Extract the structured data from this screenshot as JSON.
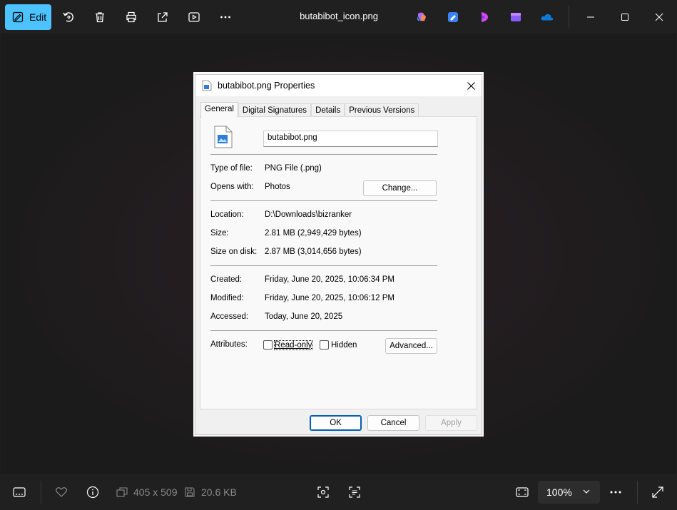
{
  "toolbar": {
    "edit_label": "Edit",
    "title": "butabibot_icon.png"
  },
  "dialog": {
    "title": "butabibot.png Properties",
    "tabs": [
      "General",
      "Digital Signatures",
      "Details",
      "Previous Versions"
    ],
    "file_name": "butabibot.png",
    "type_label": "Type of file:",
    "type_value": "PNG File (.png)",
    "opens_label": "Opens with:",
    "opens_value": "Photos",
    "change_button": "Change...",
    "location_label": "Location:",
    "location_value": "D:\\Downloads\\bizranker",
    "size_label": "Size:",
    "size_value": "2.81 MB (2,949,429 bytes)",
    "size_disk_label": "Size on disk:",
    "size_disk_value": "2.87 MB (3,014,656 bytes)",
    "created_label": "Created:",
    "created_value": "Friday, June 20, 2025, 10:06:34 PM",
    "modified_label": "Modified:",
    "modified_value": "Friday, June 20, 2025, 10:06:12 PM",
    "accessed_label": "Accessed:",
    "accessed_value": "Today, June 20, 2025",
    "attributes_label": "Attributes:",
    "readonly_label": "Read-only",
    "hidden_label": "Hidden",
    "advanced_button": "Advanced...",
    "ok_button": "OK",
    "cancel_button": "Cancel",
    "apply_button": "Apply"
  },
  "bottombar": {
    "dimensions": "405 x 509",
    "file_size": "20.6 KB",
    "zoom": "100%"
  },
  "colors": {
    "accent": "#4cc2ff",
    "toolbar_bg": "#202020",
    "dialog_bg": "#f0f0f0"
  }
}
